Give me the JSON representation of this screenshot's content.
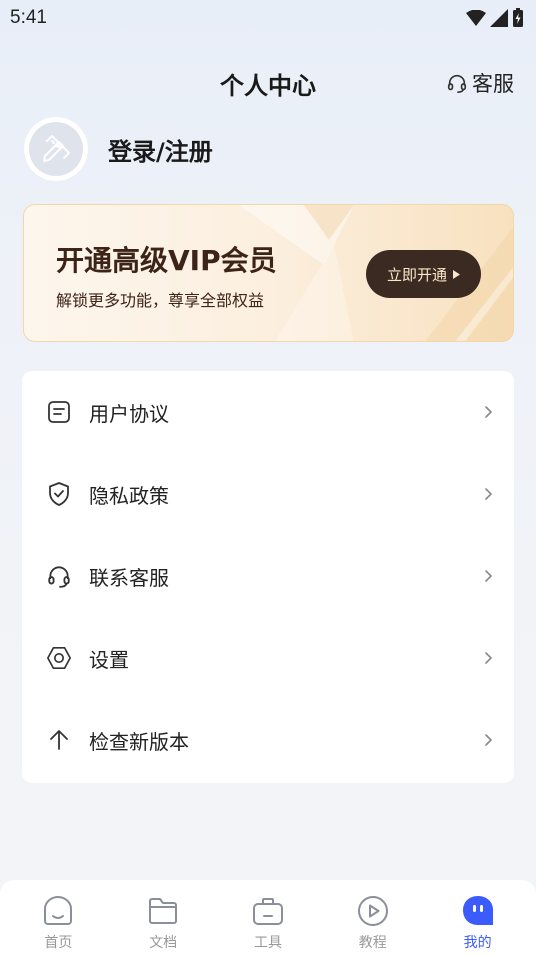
{
  "status_bar": {
    "time": "5:41"
  },
  "header": {
    "title": "个人中心",
    "service_label": "客服"
  },
  "profile": {
    "login_label": "登录/注册"
  },
  "vip_banner": {
    "title": "开通高级VIP会员",
    "subtitle": "解锁更多功能，尊享全部权益",
    "button_label": "立即开通"
  },
  "menu": {
    "items": [
      {
        "label": "用户协议",
        "icon": "document-icon"
      },
      {
        "label": "隐私政策",
        "icon": "shield-check-icon"
      },
      {
        "label": "联系客服",
        "icon": "headset-icon"
      },
      {
        "label": "设置",
        "icon": "settings-hexagon-icon"
      },
      {
        "label": "检查新版本",
        "icon": "arrow-up-icon"
      }
    ]
  },
  "tabbar": {
    "items": [
      {
        "label": "首页",
        "icon": "home-smile-icon",
        "active": false
      },
      {
        "label": "文档",
        "icon": "folder-icon",
        "active": false
      },
      {
        "label": "工具",
        "icon": "toolbox-icon",
        "active": false
      },
      {
        "label": "教程",
        "icon": "play-circle-icon",
        "active": false
      },
      {
        "label": "我的",
        "icon": "profile-bubble-icon",
        "active": true
      }
    ]
  },
  "colors": {
    "accent": "#3b5bfd",
    "vip_text": "#3d2418",
    "vip_button_bg": "#3a2a22",
    "vip_button_text": "#fbe7c8"
  }
}
